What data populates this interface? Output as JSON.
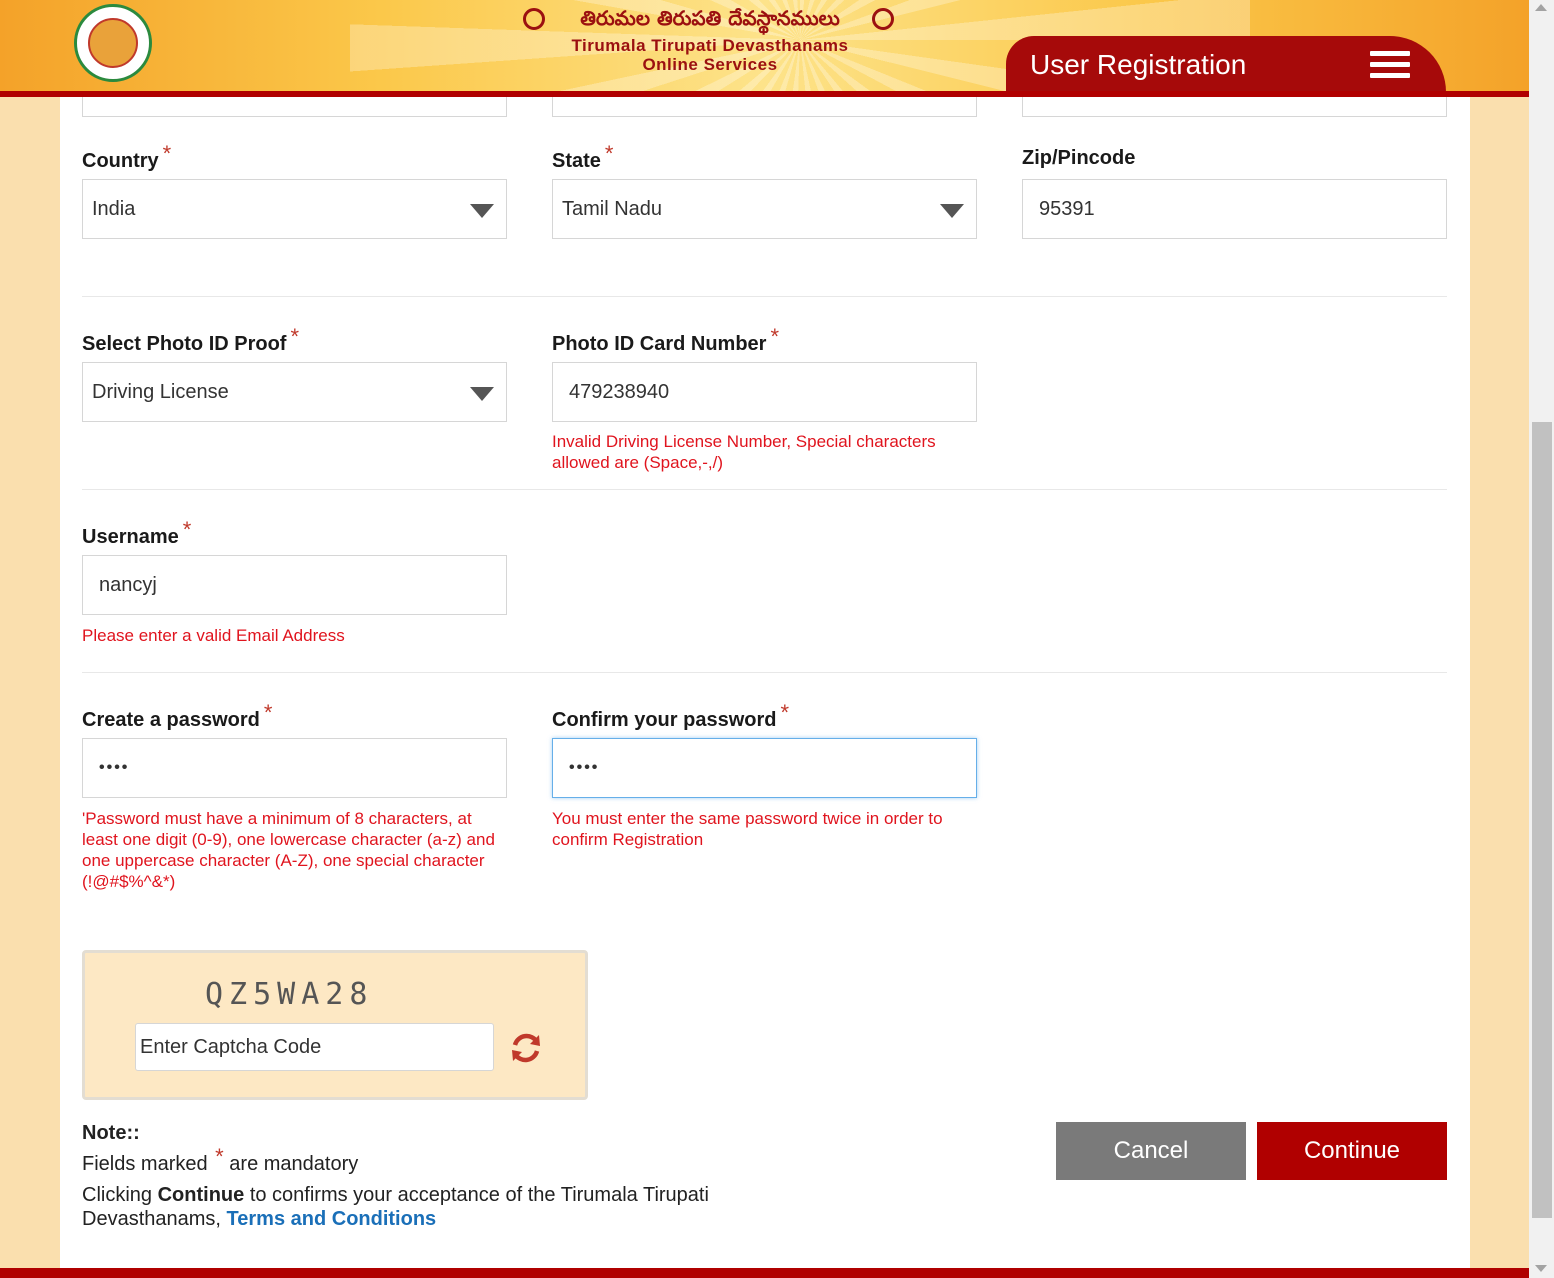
{
  "header": {
    "title_telugu": "తిరుమల తిరుపతి దేవస్థానములు",
    "title_line2": "Tirumala Tirupati Devasthanams",
    "title_line3": "Online Services",
    "page_title": "User Registration"
  },
  "form": {
    "required_marker": "*",
    "country": {
      "label": "Country",
      "value": "India"
    },
    "state": {
      "label": "State",
      "value": "Tamil Nadu"
    },
    "zip": {
      "label": "Zip/Pincode",
      "value": "95391"
    },
    "photo_id_proof": {
      "label": "Select Photo ID Proof",
      "value": "Driving License"
    },
    "photo_id_number": {
      "label": "Photo ID Card Number",
      "value": "479238940",
      "error": "Invalid Driving License Number, Special characters allowed are (Space,-,/)"
    },
    "username": {
      "label": "Username",
      "value": "nancyj",
      "error": "Please enter a valid Email Address"
    },
    "password": {
      "label": "Create a password",
      "value": "••••",
      "error": "'Password must have a minimum of 8 characters, at least one digit (0-9), one lowercase character (a-z) and one uppercase character (A-Z), one special character (!@#$%^&*)"
    },
    "confirm_password": {
      "label": "Confirm your password",
      "value": "••••",
      "error": "You must enter the same password twice in order to confirm Registration"
    }
  },
  "captcha": {
    "code": "QZ5WA28",
    "placeholder": "Enter Captcha Code",
    "refresh_icon": "refresh-icon"
  },
  "note": {
    "title": "Note::",
    "fields_marked": "Fields marked",
    "asterisk": "*",
    "are_mandatory": "are mandatory",
    "clicking": "Clicking",
    "continue_word": "Continue",
    "rest": "to confirms your acceptance of the Tirumala Tirupati Devasthanams,",
    "terms_link": "Terms and Conditions"
  },
  "buttons": {
    "cancel": "Cancel",
    "continue": "Continue"
  },
  "colors": {
    "brand_red": "#b00000",
    "error_red": "#e0141e",
    "link_blue": "#1a6fb8",
    "page_bg": "#fadfae"
  }
}
